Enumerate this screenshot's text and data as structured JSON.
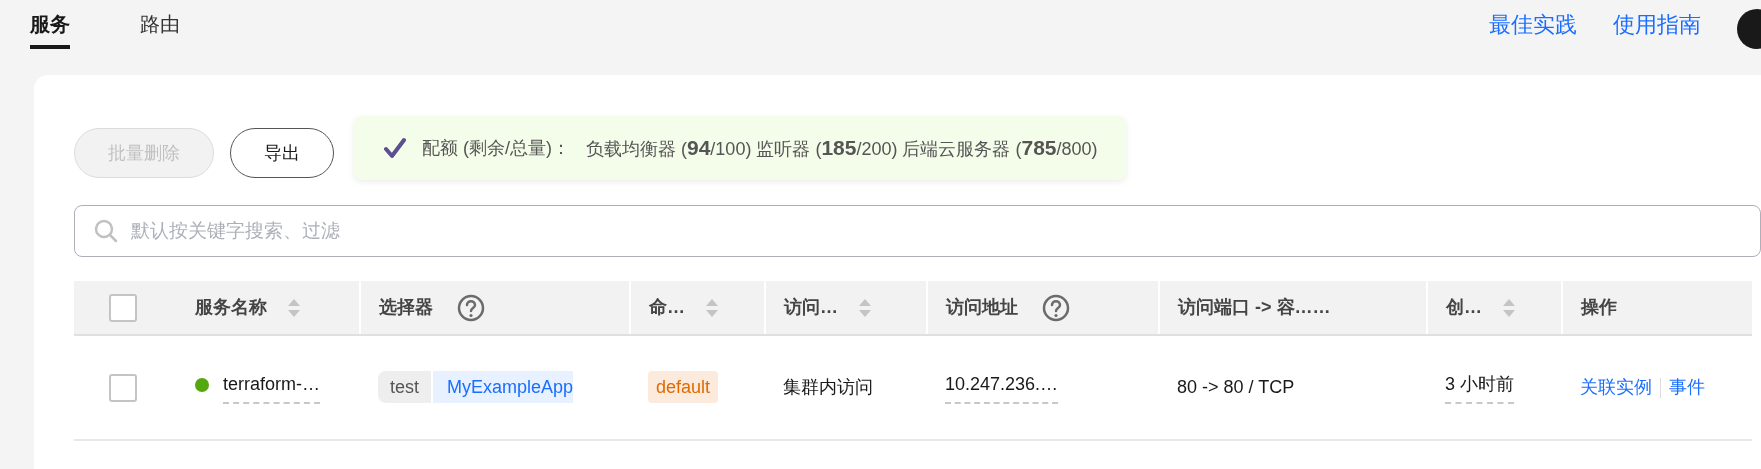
{
  "tabs": [
    {
      "label": "服务",
      "selected": true
    },
    {
      "label": "路由",
      "selected": false
    }
  ],
  "header_links": [
    "最佳实践",
    "使用指南"
  ],
  "toolbar": {
    "buttons": [
      {
        "label": "批量删除",
        "disabled": true
      },
      {
        "label": "导出",
        "disabled": false
      }
    ],
    "quota": {
      "label": "配额 (剩余/总量)：",
      "text": "负载均衡器 (**94**/100) 监听器 (**185**/200) 后端云服务器 (**785**/800)"
    }
  },
  "search": {
    "placeholder": "默认按关键字搜索、过滤"
  },
  "table": {
    "select_all": {
      "checked": false
    },
    "columns": [
      {
        "label": "服务名称",
        "kind": "sortable"
      },
      {
        "label": "选择器",
        "kind": "help"
      },
      {
        "label": "命…",
        "kind": "sortable"
      },
      {
        "label": "访问…",
        "kind": "sortable"
      },
      {
        "label": "访问地址",
        "kind": "help"
      },
      {
        "label": "访问端口 -> 容……",
        "kind": "plain"
      },
      {
        "label": "创…",
        "kind": "sortable"
      },
      {
        "label": "操作",
        "kind": "plain"
      }
    ],
    "rows": [
      {
        "checked": false,
        "color": "#52a80e",
        "name": "terraform-…",
        "selector": {
          "key": "test",
          "value": "MyExampleApp"
        },
        "namespace": "default",
        "access_type": "集群内访问",
        "address": "10.247.236.…",
        "ports": "80 -> 80 / TCP",
        "created": "3 小时前",
        "actions": [
          "关联实例",
          "事件"
        ]
      }
    ]
  }
}
